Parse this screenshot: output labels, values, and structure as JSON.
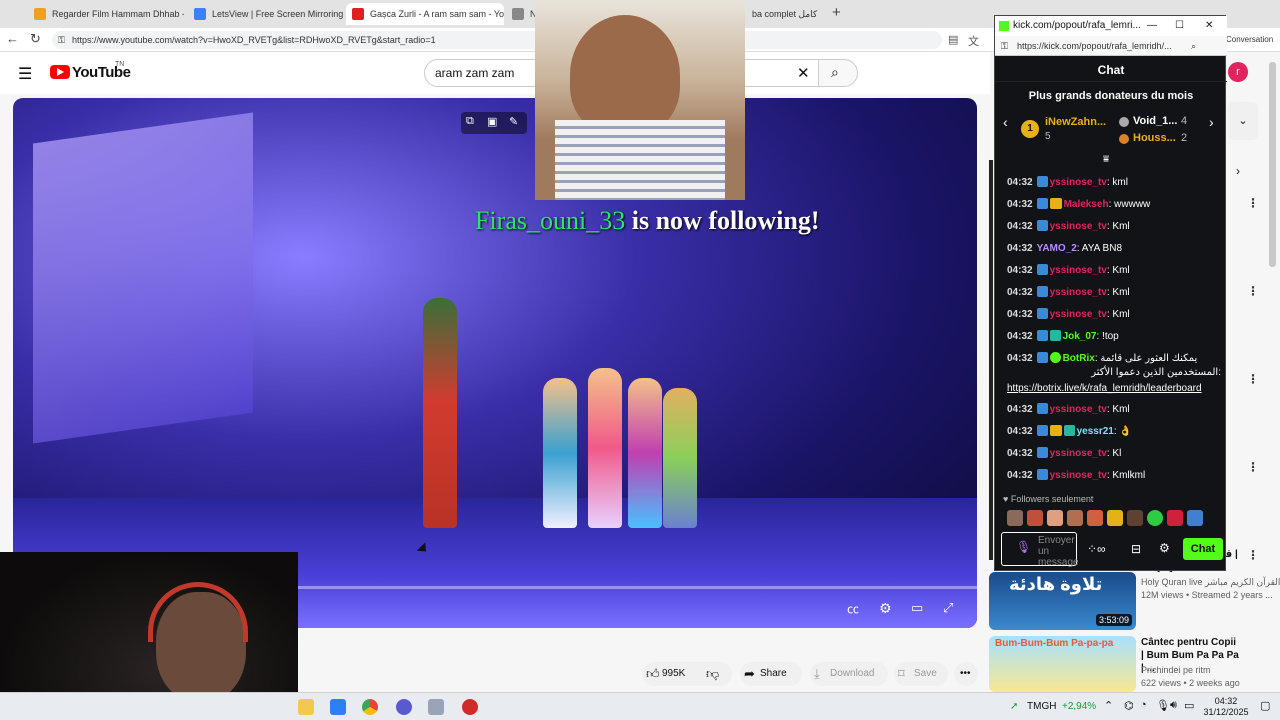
{
  "browser": {
    "tabs": [
      {
        "label": "Regarder Film Hammam Dhhab - ",
        "color": "#f0a020"
      },
      {
        "label": "LetsView | Free Screen Mirroring A",
        "color": "#3b82f6"
      },
      {
        "label": "Gașca Zurli - A ram sam sam - You",
        "color": "#e02020"
      },
      {
        "label": "No",
        "color": "#555555"
      },
      {
        "label": "ba complet كامل",
        "color": "#555555"
      }
    ],
    "url": "https://www.youtube.com/watch?v=HwoXD_RVETg&list=RDHwoXD_RVETg&start_radio=1",
    "conversation_label": "Conversation"
  },
  "youtube": {
    "logo": "YouTube",
    "region": "TN",
    "search_value": "aram zam zam",
    "avatar_letter": "r",
    "overlay_follow": {
      "name": "Firas_ouni_33",
      "text": " is now following!"
    },
    "actions": {
      "likes": "995K",
      "share": "Share",
      "download": "Download",
      "save": "Save"
    },
    "recommendations": [
      {
        "title": "قرآن الكريم مباشر | Holy Quran live",
        "channel": "Holy Quran live القرآن الكريم مباشر",
        "meta": "12M views • Streamed 2 years ...",
        "duration": "3:53:09"
      },
      {
        "title": "Cântec pentru Copii | Bum Bum Pa Pa Pa | ...",
        "channel": "Prichindei pe ritm",
        "meta": "622 views • 2 weeks ago",
        "duration": ""
      }
    ],
    "thumb_texts": {
      "quran": "تلاوة هادئة",
      "bumbum": "Bum-Bum-Bum Pa-pa-pa"
    }
  },
  "kick": {
    "window_title": "kick.com/popout/rafa_lemri...",
    "url": "https://kick.com/popout/rafa_lemridh/...",
    "header": "Chat",
    "donors_title": "Plus grands donateurs du mois",
    "donors": [
      {
        "rank": "1",
        "name": "iNewZahn...",
        "count": "5"
      },
      {
        "rank": "2",
        "name": "Void_1...",
        "count": "4"
      },
      {
        "rank": "3",
        "name": "Houss...",
        "count": "2"
      }
    ],
    "messages": [
      {
        "time": "04:32",
        "user": "yssinose_tv",
        "text": ": kml",
        "color": "#e0245e"
      },
      {
        "time": "04:32",
        "user": "Malekseh",
        "text": ": wwwww",
        "color": "#e0245e"
      },
      {
        "time": "04:32",
        "user": "yssinose_tv",
        "text": ": Kml",
        "color": "#e0245e"
      },
      {
        "time": "04:32",
        "user": "YAMO_2",
        "text": ": AYA BN8",
        "color": "#b98cff"
      },
      {
        "time": "04:32",
        "user": "yssinose_tv",
        "text": ": Kml",
        "color": "#e0245e"
      },
      {
        "time": "04:32",
        "user": "yssinose_tv",
        "text": ": Kml",
        "color": "#e0245e"
      },
      {
        "time": "04:32",
        "user": "yssinose_tv",
        "text": ": Kml",
        "color": "#e0245e"
      },
      {
        "time": "04:32",
        "user": "Jok_07",
        "text": ": !top",
        "color": "#53fc18"
      },
      {
        "time": "04:32",
        "user": "BotRix",
        "text": ": يمكنك العثور على قائمة",
        "color": "#53fc18"
      },
      {
        "time": "04:32",
        "user": "yssinose_tv",
        "text": ": Kml",
        "color": "#e0245e"
      },
      {
        "time": "04:32",
        "user": "yessr21",
        "text": ": 👌",
        "color": "#7fe3ff"
      },
      {
        "time": "04:32",
        "user": "yssinose_tv",
        "text": ": Kl",
        "color": "#e0245e"
      },
      {
        "time": "04:32",
        "user": "yssinose_tv",
        "text": ": Kmlkml",
        "color": "#e0245e"
      }
    ],
    "botrix_line2": "المستخدمين الذين دعموا الأكثر:",
    "botrix_link": "https://botrix.live/k/rafa_lemridh/leaderboard",
    "followers_only": "Followers seulement",
    "input_placeholder": "Envoyer un message",
    "chat_button": "Chat"
  },
  "taskbar": {
    "ticker": "TMGH",
    "ticker_change": "+2,94%",
    "time": "04:32",
    "date": "31/12/2025"
  }
}
